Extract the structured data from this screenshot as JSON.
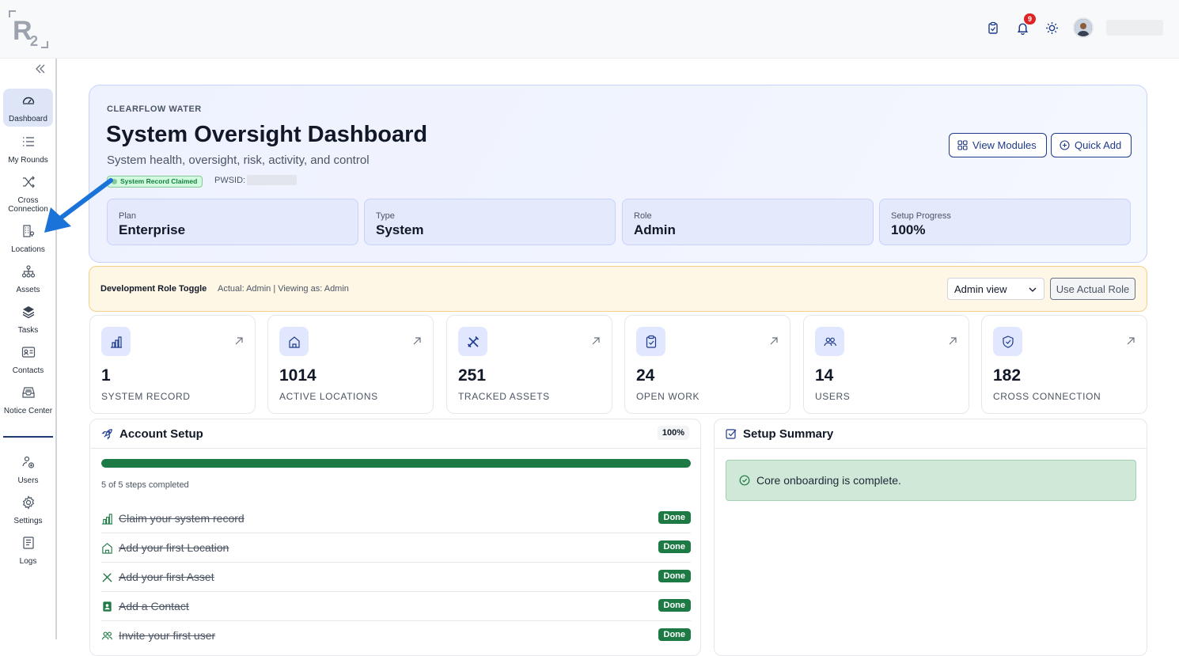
{
  "brand": {
    "logo_text": "R2"
  },
  "header": {
    "notification_count": "9"
  },
  "sidebar": {
    "items": [
      {
        "label": "Dashboard",
        "icon": "gauge-icon",
        "active": true
      },
      {
        "label": "My Rounds",
        "icon": "list-icon"
      },
      {
        "label": "Cross Connection",
        "icon": "shuffle-icon"
      },
      {
        "label": "Locations",
        "icon": "building-icon"
      },
      {
        "label": "Assets",
        "icon": "hierarchy-icon"
      },
      {
        "label": "Tasks",
        "icon": "layers-icon"
      },
      {
        "label": "Contacts",
        "icon": "contact-card-icon"
      },
      {
        "label": "Notice Center",
        "icon": "inbox-icon"
      },
      {
        "label": "Users",
        "icon": "users-icon"
      },
      {
        "label": "Settings",
        "icon": "gear-icon"
      },
      {
        "label": "Logs",
        "icon": "log-icon"
      }
    ]
  },
  "hero": {
    "org": "CLEARFLOW WATER",
    "title": "System Oversight Dashboard",
    "subtitle": "System health, oversight, risk, activity, and control",
    "claimed_badge": "System Record Claimed",
    "pwsid_label": "PWSID:",
    "view_modules": "View Modules",
    "quick_add": "Quick Add",
    "stats": [
      {
        "label": "Plan",
        "value": "Enterprise"
      },
      {
        "label": "Type",
        "value": "System"
      },
      {
        "label": "Role",
        "value": "Admin"
      },
      {
        "label": "Setup Progress",
        "value": "100%"
      }
    ]
  },
  "dev": {
    "title": "Development Role Toggle",
    "info": "Actual: Admin | Viewing as: Admin",
    "select_value": "Admin view",
    "button": "Use Actual Role"
  },
  "cards": [
    {
      "value": "1",
      "label": "SYSTEM RECORD",
      "icon": "chart-building-icon"
    },
    {
      "value": "1014",
      "label": "ACTIVE LOCATIONS",
      "icon": "home-icon"
    },
    {
      "value": "251",
      "label": "TRACKED ASSETS",
      "icon": "tools-icon"
    },
    {
      "value": "24",
      "label": "OPEN WORK",
      "icon": "clipboard-check-icon"
    },
    {
      "value": "14",
      "label": "USERS",
      "icon": "users-icon"
    },
    {
      "value": "182",
      "label": "CROSS CONNECTION",
      "icon": "shield-check-icon"
    }
  ],
  "account_setup": {
    "title": "Account Setup",
    "percent": "100%",
    "progress": 1.0,
    "steps_text": "5 of 5 steps completed",
    "steps": [
      {
        "label": "Claim your system record",
        "status": "Done"
      },
      {
        "label": "Add your first Location",
        "status": "Done"
      },
      {
        "label": "Add your first Asset",
        "status": "Done"
      },
      {
        "label": "Add a Contact",
        "status": "Done"
      },
      {
        "label": "Invite your first user",
        "status": "Done"
      }
    ]
  },
  "setup_summary": {
    "title": "Setup Summary",
    "message": "Core onboarding is complete."
  },
  "colors": {
    "accent": "#1e3a8a",
    "success": "#1e7a45",
    "annotation_arrow": "#1a73d9"
  }
}
